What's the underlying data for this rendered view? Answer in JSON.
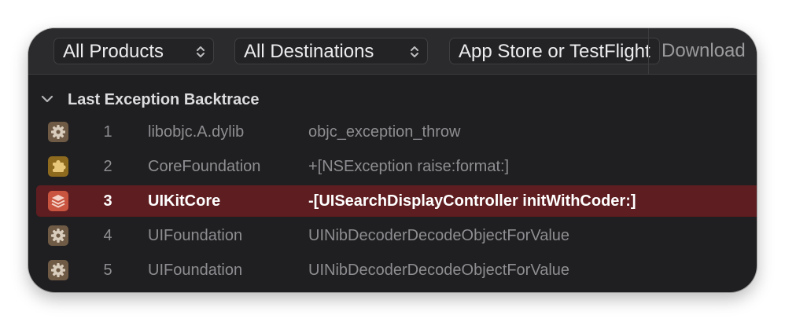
{
  "toolbar": {
    "products_label": "All Products",
    "destinations_label": "All Destinations",
    "distribution_label": "App Store or TestFlight",
    "download_label": "Download"
  },
  "backtrace": {
    "title": "Last Exception Backtrace",
    "rows": [
      {
        "index": "1",
        "library": "libobjc.A.dylib",
        "symbol": "objc_exception_throw",
        "icon": "gear-icon",
        "selected": false
      },
      {
        "index": "2",
        "library": "CoreFoundation",
        "symbol": "+[NSException raise:format:]",
        "icon": "puzzle-icon",
        "selected": false
      },
      {
        "index": "3",
        "library": "UIKitCore",
        "symbol": "-[UISearchDisplayController initWithCoder:]",
        "icon": "stack-icon",
        "selected": true
      },
      {
        "index": "4",
        "library": "UIFoundation",
        "symbol": "UINibDecoderDecodeObjectForValue",
        "icon": "gear-icon",
        "selected": false
      },
      {
        "index": "5",
        "library": "UIFoundation",
        "symbol": "UINibDecoderDecodeObjectForValue",
        "icon": "gear-icon",
        "selected": false
      }
    ]
  },
  "colors": {
    "selection": "#5e1d20",
    "gear_icon_bg": "#6f5a45",
    "puzzle_icon_bg": "#8e6a1f",
    "stack_icon_bg": "#c9543f"
  }
}
